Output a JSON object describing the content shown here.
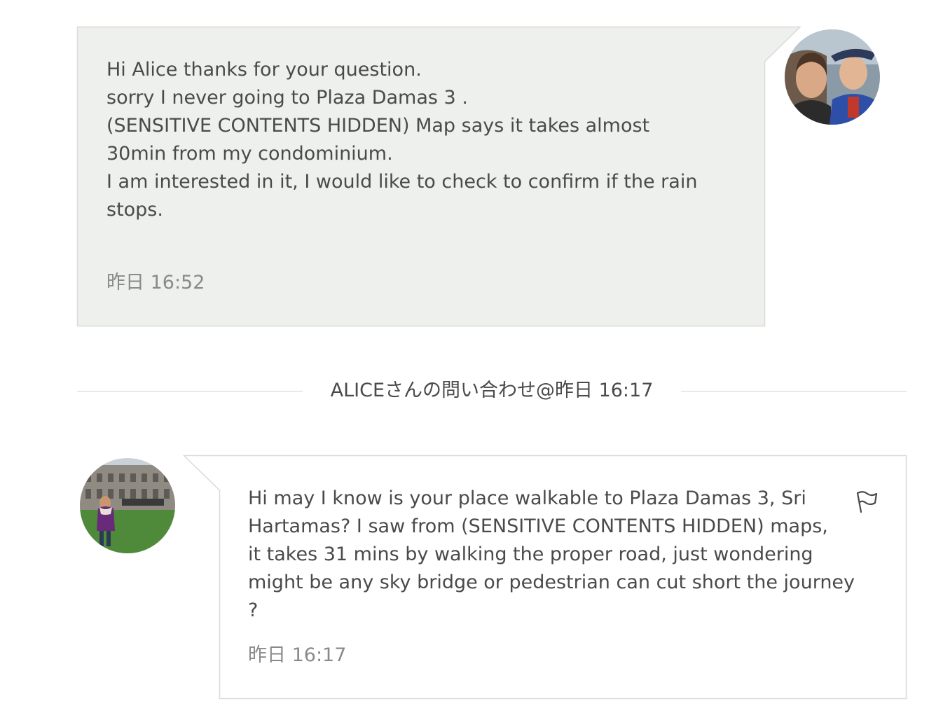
{
  "host_message": {
    "text": "Hi Alice thanks for your question.\nsorry I never going to Plaza Damas 3 .\n(SENSITIVE CONTENTS HIDDEN) Map says it takes almost\n30min from my condominium.\nI am interested in it, I would like to check to confirm if the rain\nstops.",
    "time": "昨日 16:52",
    "bubble_color": "#eef0ed"
  },
  "divider": {
    "label": "ALICEさんの問い合わせ@昨日 16:17"
  },
  "guest_message": {
    "text": "Hi may I know is your place walkable to Plaza Damas 3, Sri\nHartamas? I saw from (SENSITIVE CONTENTS HIDDEN) maps,\nit takes 31 mins by walking the proper road, just wondering\nmight be any sky bridge or pedestrian can cut short the journey\n?",
    "time": "昨日 16:17",
    "flag_icon": "flag-icon"
  }
}
